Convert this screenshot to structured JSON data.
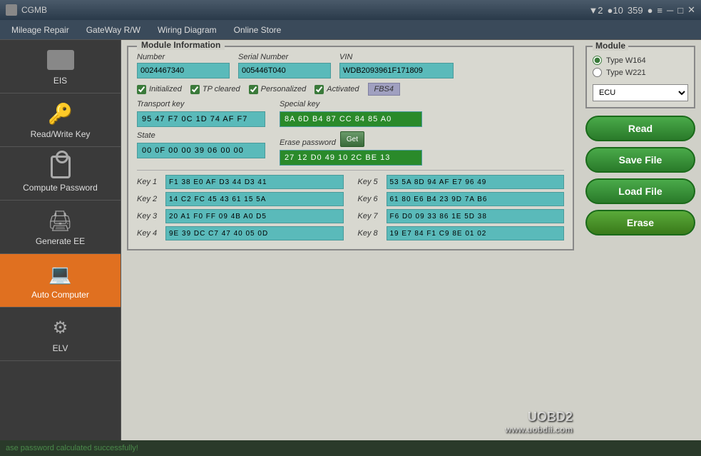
{
  "app": {
    "title": "CGMB",
    "title_icon": "◼"
  },
  "title_bar": {
    "controls": [
      "▼ 2",
      "● 10",
      "359",
      "●",
      "≡",
      "─",
      "□",
      "✕"
    ]
  },
  "menu": {
    "items": [
      "Mileage Repair",
      "GateWay R/W",
      "Wiring Diagram",
      "Online Store"
    ],
    "right": {
      "wifi": "▼ 2",
      "signal": "● 10",
      "count": "359"
    }
  },
  "sidebar": {
    "items": [
      {
        "id": "eis",
        "label": "EIS",
        "icon": "eis",
        "active": false
      },
      {
        "id": "read-write-key",
        "label": "Read/Write Key",
        "icon": "key",
        "active": false
      },
      {
        "id": "compute-password",
        "label": "Compute Password",
        "icon": "lock",
        "active": false
      },
      {
        "id": "generate-ee",
        "label": "Generate EE",
        "icon": "gear",
        "active": false
      },
      {
        "id": "auto-computer",
        "label": "Auto Computer",
        "icon": "computer",
        "active": true
      },
      {
        "id": "elv",
        "label": "ELV",
        "icon": "elv",
        "active": false
      }
    ]
  },
  "module_info": {
    "panel_title": "Module Information",
    "number_label": "Number",
    "number_value": "0024467340",
    "serial_label": "Serial Number",
    "serial_value": "005446T040",
    "vin_label": "VIN",
    "vin_value": "WDB2093961F171809",
    "checkboxes": [
      {
        "label": "Initialized",
        "checked": true
      },
      {
        "label": "TP cleared",
        "checked": true
      },
      {
        "label": "Personalized",
        "checked": true
      },
      {
        "label": "Activated",
        "checked": true
      }
    ],
    "fbs4_label": "FBS4",
    "transport_key_label": "Transport key",
    "transport_key_value": "95 47 F7 0C 1D 74 AF F7",
    "special_key_label": "Special key",
    "special_key_value": "8A 6D B4 87 CC 84 85 A0",
    "state_label": "State",
    "state_value": "00 0F 00 00 39 06 00 00",
    "erase_password_label": "Erase password",
    "erase_password_value": "27 12 D0 49 10 2C BE 13",
    "get_btn_label": "Get",
    "keys": [
      {
        "num": "Key 1",
        "value": "F1 38 E0 AF D3 44 D3 41"
      },
      {
        "num": "Key 2",
        "value": "14 C2 FC 45 43 61 15 5A"
      },
      {
        "num": "Key 3",
        "value": "20 A1 F0 FF 09 4B A0 D5"
      },
      {
        "num": "Key 4",
        "value": "9E 39 DC C7 47 40 05 0D"
      },
      {
        "num": "Key 5",
        "value": "53 5A 8D 94 AF E7 96 49"
      },
      {
        "num": "Key 6",
        "value": "61 80 E6 B4 23 9D 7A B6"
      },
      {
        "num": "Key 7",
        "value": "F6 D0 09 33 86 1E 5D 38"
      },
      {
        "num": "Key 8",
        "value": "19 E7 84 F1 C9 8E 01 02"
      }
    ]
  },
  "module_panel": {
    "title": "Module",
    "type_w164_label": "Type W164",
    "type_w221_label": "Type W221",
    "ecu_label": "ECU",
    "ecu_options": [
      "ECU"
    ]
  },
  "actions": {
    "read_label": "Read",
    "save_file_label": "Save File",
    "load_file_label": "Load File",
    "erase_label": "Erase"
  },
  "status_bar": {
    "message": "ase password calculated successfully!"
  },
  "watermark": {
    "line1": "UOBD2",
    "line2": "www.uobdii.com"
  }
}
